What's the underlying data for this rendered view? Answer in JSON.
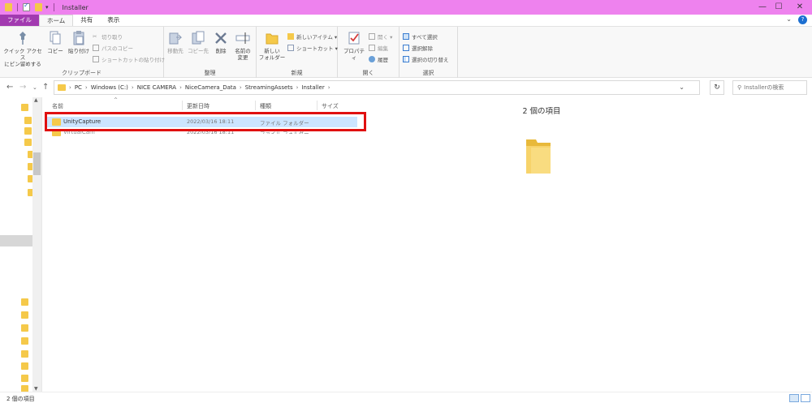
{
  "window": {
    "title": "Installer",
    "minimize": "—",
    "maximize": "☐",
    "close": "✕"
  },
  "ribbon_tabs": [
    "ファイル",
    "ホーム",
    "共有",
    "表示"
  ],
  "ribbon": {
    "clipboard": {
      "pin_label": "クイック アクセス\nにピン留めする",
      "copy": "コピー",
      "paste": "貼り付け",
      "cut": "切り取り",
      "copy_path": "パスのコピー",
      "paste_shortcut": "ショートカットの貼り付け",
      "label": "クリップボード"
    },
    "organize": {
      "move_to": "移動先",
      "copy_to": "コピー先",
      "delete": "削除",
      "rename": "名前の\n変更",
      "label": "整理"
    },
    "new": {
      "new_folder": "新しい\nフォルダー",
      "new_item": "新しいアイテム ▾",
      "shortcut": "ショートカット ▾",
      "label": "新規"
    },
    "open": {
      "properties": "プロパティ",
      "open": "開く ▾",
      "edit": "編集",
      "history": "履歴",
      "label": "開く"
    },
    "select": {
      "select_all": "すべて選択",
      "select_none": "選択解除",
      "invert": "選択の切り替え",
      "label": "選択"
    }
  },
  "address": {
    "crumbs": [
      "PC",
      "Windows (C:)",
      "NICE CAMERA",
      "NiceCamera_Data",
      "StreamingAssets",
      "Installer"
    ],
    "search_placeholder": "Installerの検索"
  },
  "columns": {
    "name": "名前",
    "date": "更新日時",
    "type": "種類",
    "size": "サイズ"
  },
  "files": [
    {
      "name": "UnityCapture",
      "date": "2022/03/16 18:11",
      "type": "ファイル フォルダー"
    },
    {
      "name": "VirtualCam",
      "date": "2022/03/16 18:11",
      "type": "ファイル フォルダー"
    }
  ],
  "preview": {
    "item_count": "2 個の項目"
  },
  "status": {
    "item_count": "2 個の項目"
  },
  "colors": {
    "titlebar": "#ee82ee",
    "file_tab": "#a23ab0",
    "folder": "#f5c94a",
    "selection": "#cce5ff",
    "highlight": "#e01010"
  }
}
